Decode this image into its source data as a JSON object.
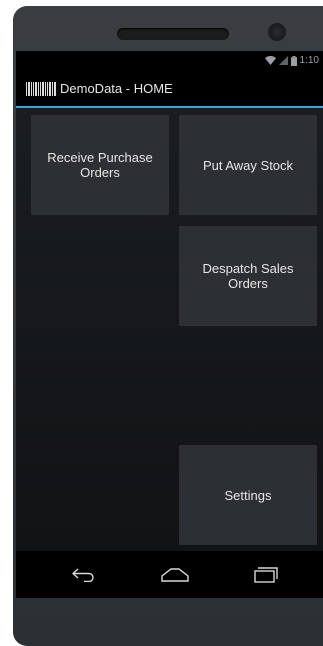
{
  "status_bar": {
    "time": "1:10",
    "icons": [
      "wifi-icon",
      "signal-icon",
      "battery-icon"
    ]
  },
  "action_bar": {
    "app_icon": "barcode-icon",
    "title": "DemoData - HOME"
  },
  "menu": {
    "receive_purchase_orders": "Receive Purchase Orders",
    "put_away_stock": "Put Away Stock",
    "despatch_sales_orders": "Despatch Sales Orders",
    "settings": "Settings"
  },
  "nav_bar": {
    "icons": [
      "back-icon",
      "home-icon",
      "recents-icon"
    ]
  },
  "colors": {
    "accent": "#3aa4d8",
    "tile": "#2c3034",
    "bar": "#000000"
  }
}
